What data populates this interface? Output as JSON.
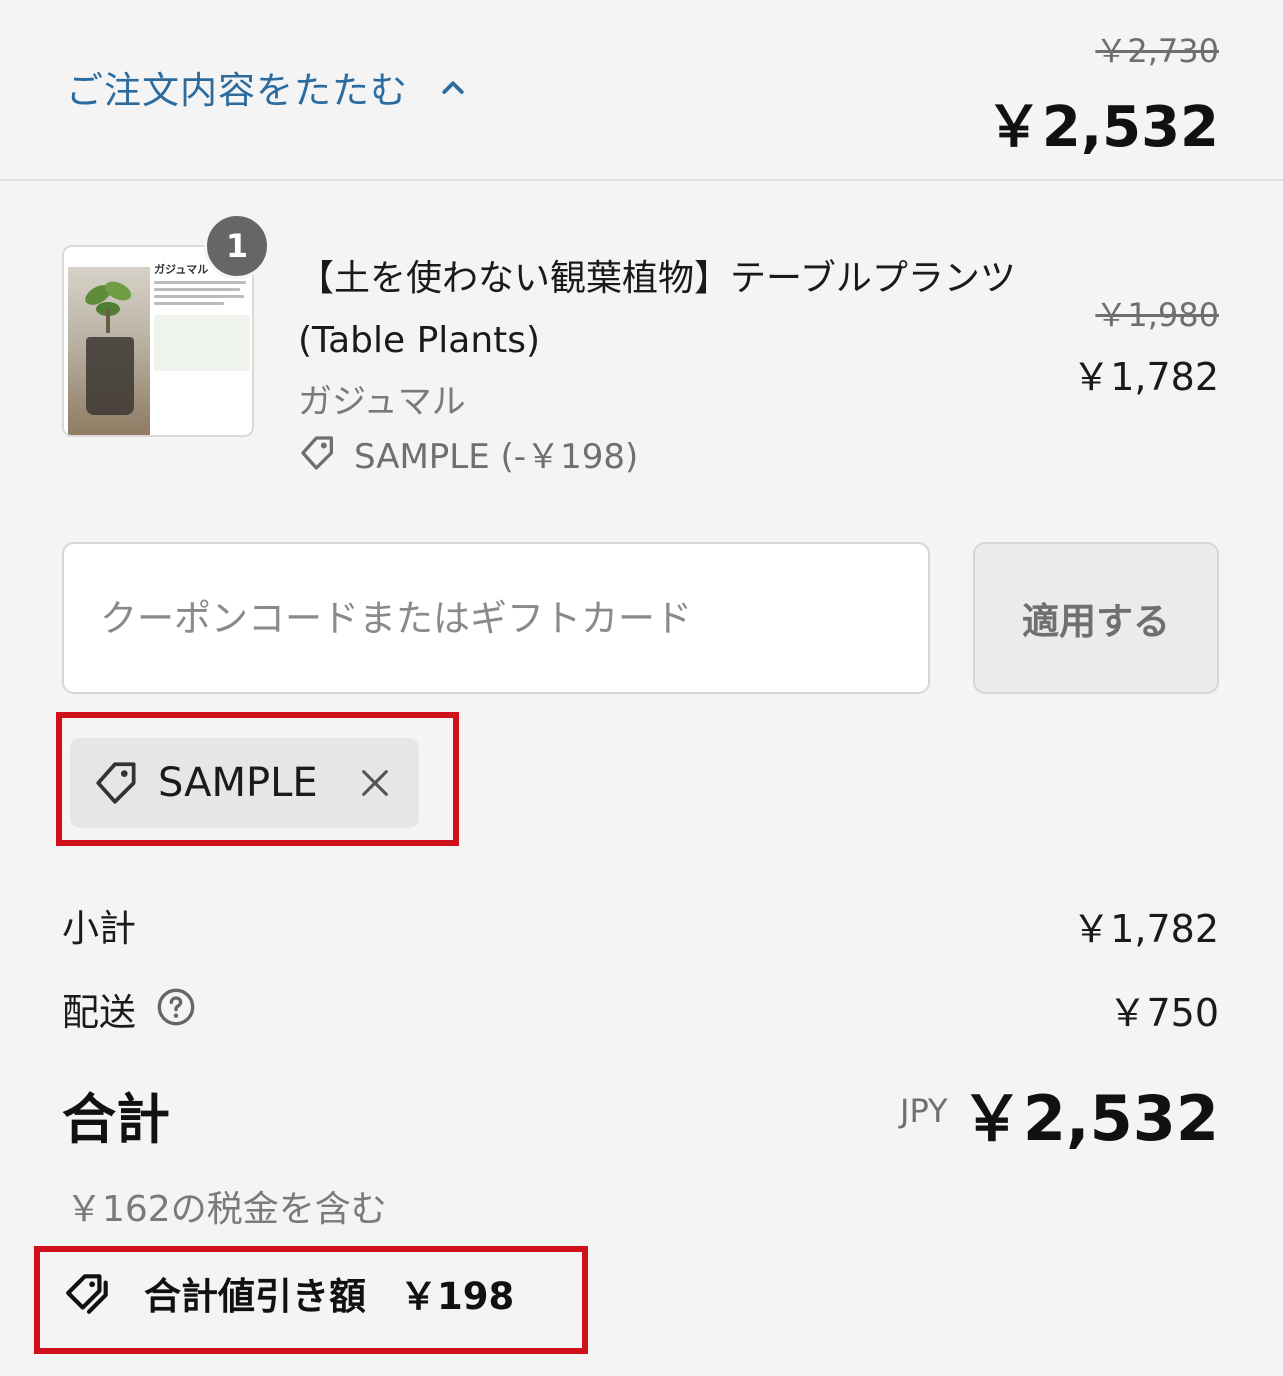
{
  "header": {
    "toggle_label": "ご注文内容をたたむ",
    "compare_total": "￥2,730",
    "total": "￥2,532"
  },
  "product": {
    "quantity": "1",
    "title": "【土を使わない観葉植物】テーブルプランツ(Table Plants)",
    "variant": "ガジュマル",
    "discount": "SAMPLE (-￥198)",
    "compare_price": "￥1,980",
    "price": "￥1,782",
    "image_caption": "ガジュマル"
  },
  "coupon": {
    "placeholder": "クーポンコードまたはギフトカード",
    "value": "",
    "apply_label": "適用する"
  },
  "applied_code": {
    "label": "SAMPLE"
  },
  "summary": {
    "subtotal_label": "小計",
    "subtotal_value": "￥1,782",
    "shipping_label": "配送",
    "shipping_value": "￥750",
    "total_label": "合計",
    "currency": "JPY",
    "total_value": "￥2,532",
    "tax_note": "￥162の税金を含む",
    "savings_label": "合計値引き額",
    "savings_value": "￥198"
  },
  "colors": {
    "link": "#2b6b9e",
    "highlight": "#d0101a",
    "background": "#f4f4f4"
  }
}
